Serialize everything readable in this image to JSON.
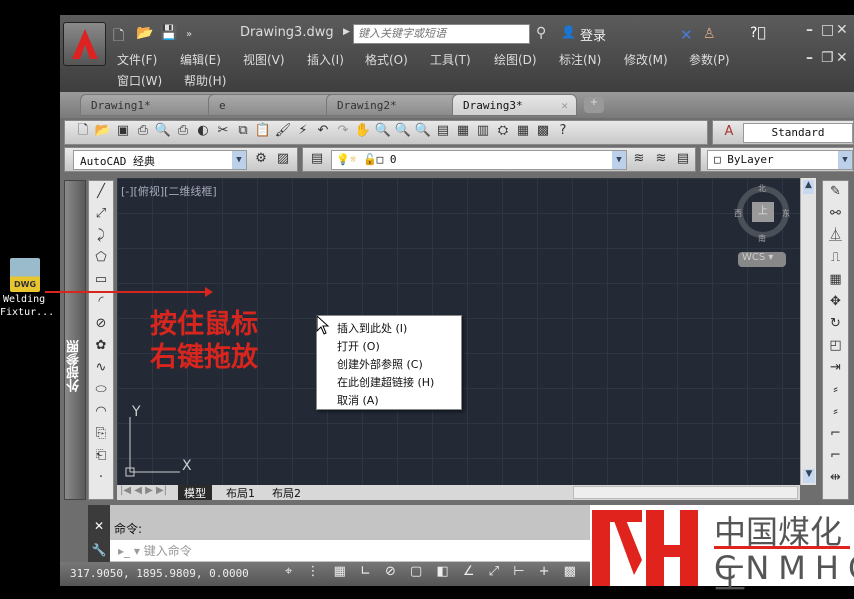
{
  "desktop": {
    "file_icon_label": "DWG",
    "file_name_line1": "Welding",
    "file_name_line2": "Fixtur..."
  },
  "titlebar": {
    "doc_title": "Drawing3.dwg",
    "search_placeholder": "键入关键字或短语",
    "login": "登录"
  },
  "menu": [
    "文件(F)",
    "编辑(E)",
    "视图(V)",
    "插入(I)",
    "格式(O)",
    "工具(T)",
    "绘图(D)",
    "标注(N)",
    "修改(M)",
    "参数(P)",
    "窗口(W)",
    "帮助(H)"
  ],
  "tabs": [
    "Drawing1*",
    "e",
    "Drawing2*",
    "Drawing3*"
  ],
  "toolbar": {
    "text_style": "Standard",
    "workspace": "AutoCAD 经典",
    "layer": "0",
    "color": "ByLayer"
  },
  "palette": {
    "label": "外部参照"
  },
  "viewport": {
    "label": "[-][俯视][二维线框]",
    "compass": {
      "n": "北",
      "s": "南",
      "e": "东",
      "w": "西",
      "top": "上"
    },
    "wcs": "WCS"
  },
  "layout_tabs": [
    "模型",
    "布局1",
    "布局2"
  ],
  "context_menu": [
    "插入到此处 (I)",
    "打开 (O)",
    "创建外部参照 (C)",
    "在此创建超链接 (H)",
    "取消 (A)"
  ],
  "annotation": {
    "line1": "按住鼠标",
    "line2": "右键拖放"
  },
  "command": {
    "prompt": "命令:",
    "placeholder": "键入命令"
  },
  "status": {
    "coords": "317.9050,  1895.9809, 0.0000"
  },
  "watermark": {
    "cn": "中国煤化工",
    "en": "CNMHG",
    "brand_color": "#e0231c"
  }
}
